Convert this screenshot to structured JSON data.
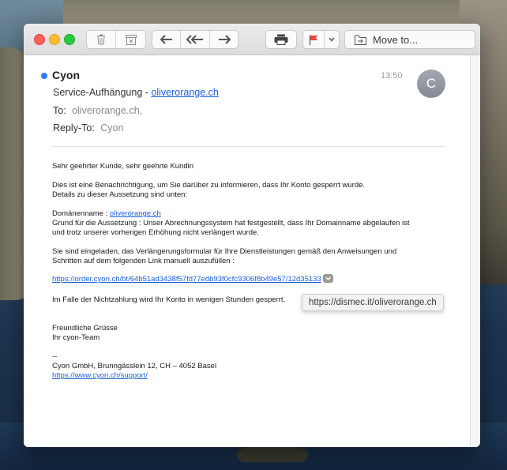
{
  "toolbar": {
    "move_to_label": "Move to..."
  },
  "message": {
    "sender": "Cyon",
    "time": "13:50",
    "avatar_letter": "C",
    "subject_prefix": "Service-Aufhängung - ",
    "subject_link": "oliverorange.ch",
    "to_label": "To:",
    "to_value": "oliverorange.ch,",
    "reply_to_label": "Reply-To:",
    "reply_to_value": "Cyon"
  },
  "body": {
    "greeting": "Sehr geehrter Kunde, sehr geehrte Kundin",
    "p1_line1": "Dies ist eine Benachrichtigung, um Sie darüber zu informieren, dass Ihr Konto gesperrt wurde.",
    "p1_line2": "Details zu dieser Aussetzung sind unten:",
    "domain_label": "Domänenname : ",
    "domain_link": "oliverorange.ch",
    "reason_line1": "Grund für die Aussetzung : Unser Abrechnungssystem hat festgestellt, dass Ihr Domainname abgelaufen ist",
    "reason_line2": "und trotz unserer vorherigen Erhöhung nicht verlängert wurde.",
    "p3_line1": "Sie sind eingeladen, das Verlängerungsformular für Ihre Dienstleistungen gemäß den Anweisungen und",
    "p3_line2": "Schritten auf dem folgenden Link manuell auszufüllen :",
    "form_link": "https://order.cyon.ch/bt/64b51ad3438f57fd77edb93f0cfc9306f8b49e57/12d35133",
    "warning": "Im Falle der Nichtzahlung wird Ihr Konto in wenigen Stunden gesperrt.",
    "closing1": "Freundliche Grüsse",
    "closing2": "Ihr cyon-Team",
    "sig_dash": "--",
    "sig_company": "Cyon GmbH, Brunngässlein 12, CH – 4052 Basel",
    "sig_link": "https://www.cyon.ch/support/"
  },
  "tooltip": {
    "text": "https://dismec.it/oliverorange.ch"
  },
  "colors": {
    "accent": "#2f7cf6",
    "link": "#1a5fd8",
    "flag": "#e5463c"
  },
  "icons": [
    "trash-icon",
    "archive-icon",
    "reply-icon",
    "reply-all-icon",
    "forward-icon",
    "print-icon",
    "flag-icon",
    "chevron-down-icon",
    "move-folder-icon"
  ]
}
